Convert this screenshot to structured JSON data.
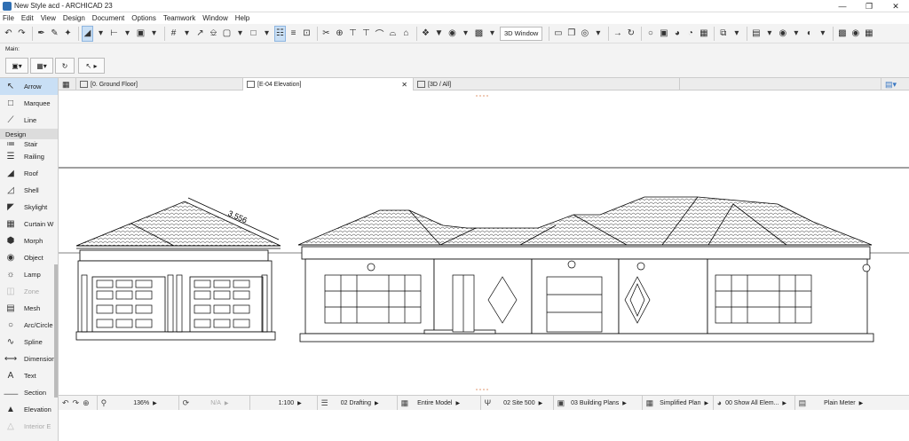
{
  "window": {
    "title": "New Style acd - ARCHICAD 23"
  },
  "menu": {
    "items": [
      "File",
      "Edit",
      "View",
      "Design",
      "Document",
      "Options",
      "Teamwork",
      "Window",
      "Help"
    ]
  },
  "toolbar": {
    "window3d_label": "3D Window"
  },
  "infobox": {
    "main_label": "Main:"
  },
  "toolbox": {
    "tools_top": [
      {
        "label": "Arrow",
        "icon": "arrow-icon",
        "selected": true,
        "dim": false
      },
      {
        "label": "Marquee",
        "icon": "marquee-icon",
        "selected": false,
        "dim": false
      },
      {
        "label": "Line",
        "icon": "line-icon",
        "selected": false,
        "dim": false
      }
    ],
    "section_label": "Design",
    "tools": [
      {
        "label": "Stair",
        "icon": "stair-icon",
        "dim": false
      },
      {
        "label": "Railing",
        "icon": "railing-icon",
        "dim": false
      },
      {
        "label": "Roof",
        "icon": "roof-icon",
        "dim": false
      },
      {
        "label": "Shell",
        "icon": "shell-icon",
        "dim": false
      },
      {
        "label": "Skylight",
        "icon": "skylight-icon",
        "dim": false
      },
      {
        "label": "Curtain W",
        "icon": "curtain-wall-icon",
        "dim": false
      },
      {
        "label": "Morph",
        "icon": "morph-icon",
        "dim": false
      },
      {
        "label": "Object",
        "icon": "object-icon",
        "dim": false
      },
      {
        "label": "Lamp",
        "icon": "lamp-icon",
        "dim": false
      },
      {
        "label": "Zone",
        "icon": "zone-icon",
        "dim": true
      },
      {
        "label": "Mesh",
        "icon": "mesh-icon",
        "dim": false
      },
      {
        "label": "Arc/Circle",
        "icon": "arc-icon",
        "dim": false
      },
      {
        "label": "Spline",
        "icon": "spline-icon",
        "dim": false
      },
      {
        "label": "Dimension",
        "icon": "dimension-icon",
        "dim": false
      },
      {
        "label": "Text",
        "icon": "text-icon",
        "dim": false
      },
      {
        "label": "Section",
        "icon": "section-icon",
        "dim": false
      },
      {
        "label": "Elevation",
        "icon": "elevation-icon",
        "dim": false
      },
      {
        "label": "Interior E",
        "icon": "interior-elevation-icon",
        "dim": true
      }
    ]
  },
  "tabs": [
    {
      "label": "[0. Ground Floor]",
      "active": false
    },
    {
      "label": "[E-04 Elevation]",
      "active": true
    },
    {
      "label": "[3D / All]",
      "active": false
    }
  ],
  "drawing": {
    "dimension_label": "3.556"
  },
  "status": {
    "zoom": "136%",
    "angle": "N/A",
    "scale": "1:100",
    "layer_combo": "02 Drafting",
    "structure": "Entire Model",
    "pen_set": "02 Site 500",
    "model_view": "03 Building Plans",
    "plan_type": "Simplified Plan",
    "renovation": "00 Show All Elem...",
    "dimension": "Plain Meter"
  }
}
